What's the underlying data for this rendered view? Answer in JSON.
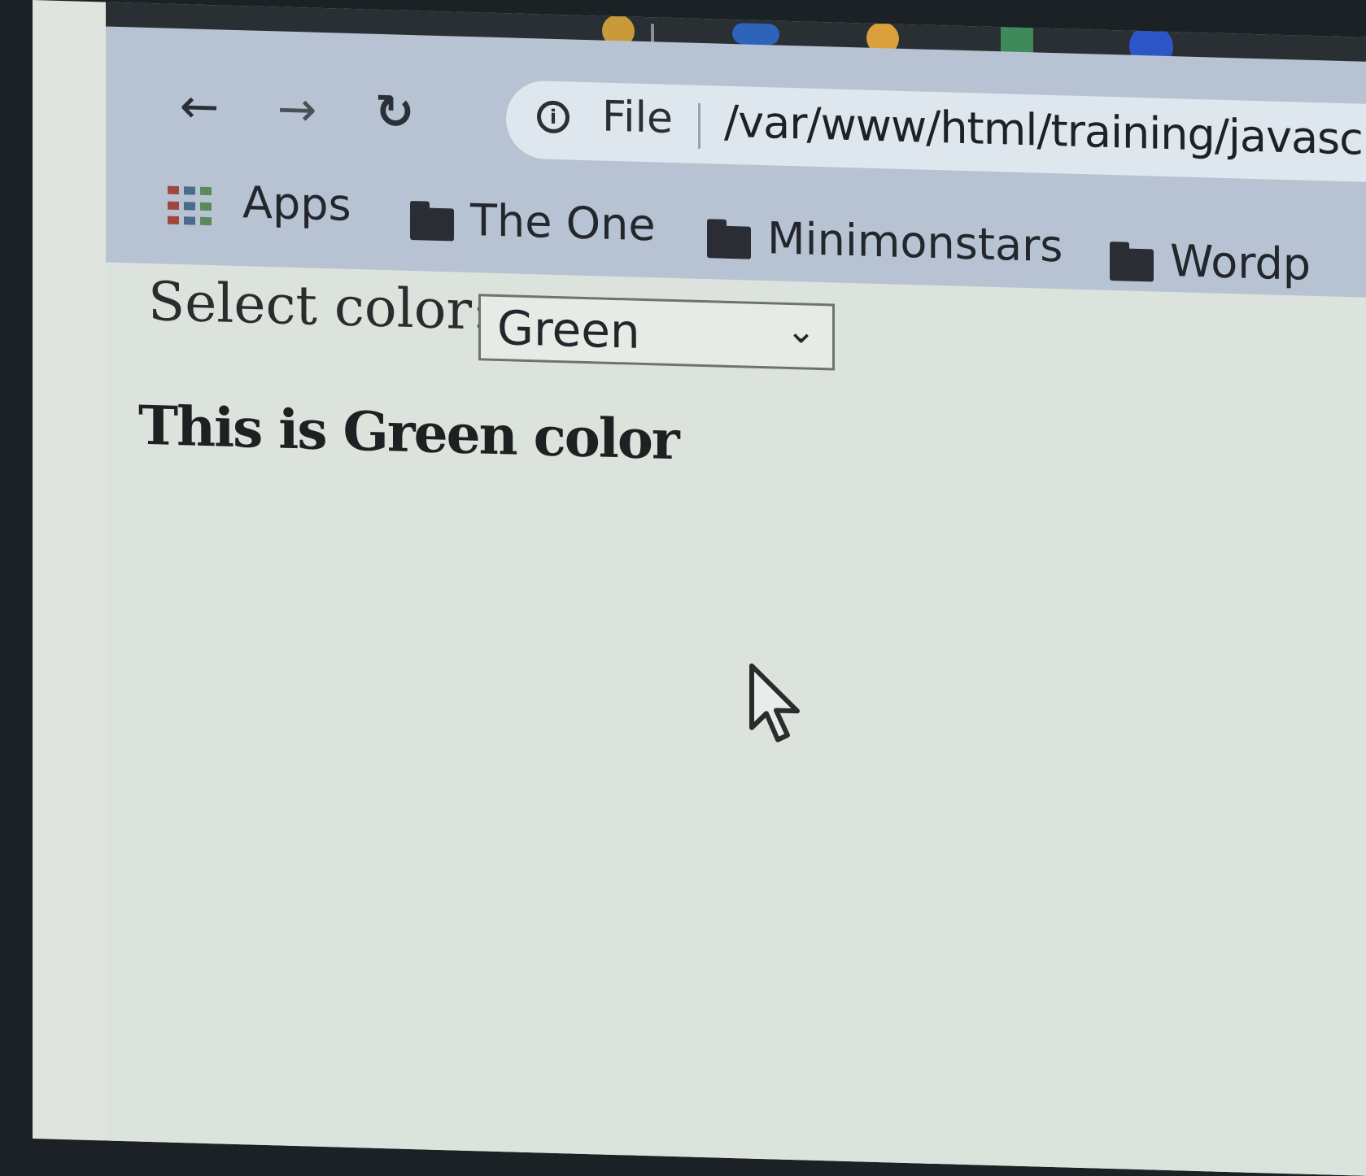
{
  "browser": {
    "nav": {
      "back_glyph": "←",
      "forward_glyph": "→",
      "reload_glyph": "↻"
    },
    "address_bar": {
      "scheme_label": "File",
      "url": "/var/www/html/training/javascrip"
    },
    "bookmarks": [
      {
        "label": "Apps",
        "icon": "apps-grid-icon"
      },
      {
        "label": "The One",
        "icon": "folder-icon"
      },
      {
        "label": "Minimonstars",
        "icon": "folder-icon"
      },
      {
        "label": "Wordp",
        "icon": "folder-icon"
      }
    ]
  },
  "page": {
    "select_label": "Select color:",
    "select_value": "Green",
    "result_text": "This is Green color"
  },
  "colors": {
    "toolbar": "#b7c3d2",
    "page_background": "#dce2dc",
    "tabstrip": "#2a2f33"
  }
}
